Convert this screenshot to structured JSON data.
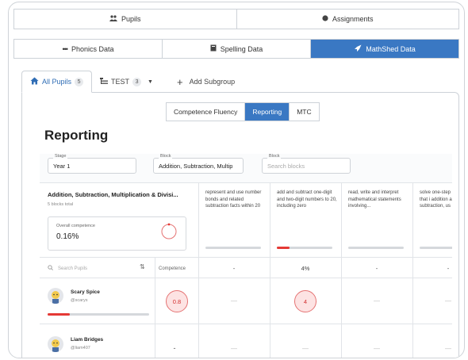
{
  "top_tabs": [
    {
      "label": "Pupils",
      "icon": "pupils-icon"
    },
    {
      "label": "Assignments",
      "icon": "assignments-icon"
    }
  ],
  "data_tabs": [
    {
      "label": "Phonics Data",
      "icon": "phonics-icon",
      "active": false
    },
    {
      "label": "Spelling Data",
      "icon": "book-icon",
      "active": false
    },
    {
      "label": "MathShed Data",
      "icon": "rocket-icon",
      "active": true
    }
  ],
  "group_tabs": {
    "all_pupils": {
      "label": "All Pupils",
      "count": "5"
    },
    "test": {
      "label": "TEST",
      "count": "3"
    },
    "add_subgroup": {
      "label": "Add Subgroup"
    }
  },
  "view_tabs": [
    "Competence Fluency",
    "Reporting",
    "MTC"
  ],
  "page_title": "Reporting",
  "filters": {
    "stage": {
      "label": "Stage",
      "value": "Year 1"
    },
    "block": {
      "label": "Block",
      "value": "Addition, Subtraction, Multip"
    },
    "block_search": {
      "label": "Block",
      "placeholder": "Search blocks"
    }
  },
  "summary": {
    "title": "Addition, Subtraction, Multiplication & Divisi...",
    "subtitle": "5 blocks total",
    "overall_label": "Overall competence",
    "overall_value": "0.16%",
    "overall_fraction": 0.0016
  },
  "objectives": [
    {
      "text": "represent and use number bonds and related subtraction facts within 20",
      "percent": "-",
      "progress": 0
    },
    {
      "text": "add and subtract one-digit and two-digit numbers to 20, including zero",
      "percent": "4%",
      "progress": 0.2
    },
    {
      "text": "read, write and interpret mathematical statements involving...",
      "percent": "-",
      "progress": 0
    },
    {
      "text": "solve one-step problems that i addition and subtraction, us",
      "percent": "-",
      "progress": 0
    }
  ],
  "table": {
    "search_placeholder": "Search Pupils",
    "sort_icon": "sort-icon",
    "competence_header": "Competence"
  },
  "pupils": [
    {
      "name": "Scary Spice",
      "username": "@scarys",
      "competence": "0.8",
      "cells": [
        "—",
        "4",
        "—",
        "—"
      ],
      "progress": 0.22
    },
    {
      "name": "Liam Bridges",
      "username": "@liam407",
      "competence": "-",
      "cells": [
        "—",
        "—",
        "—",
        "—"
      ],
      "progress": 0
    }
  ],
  "colors": {
    "accent": "#3a78c3",
    "danger": "#e53935"
  }
}
